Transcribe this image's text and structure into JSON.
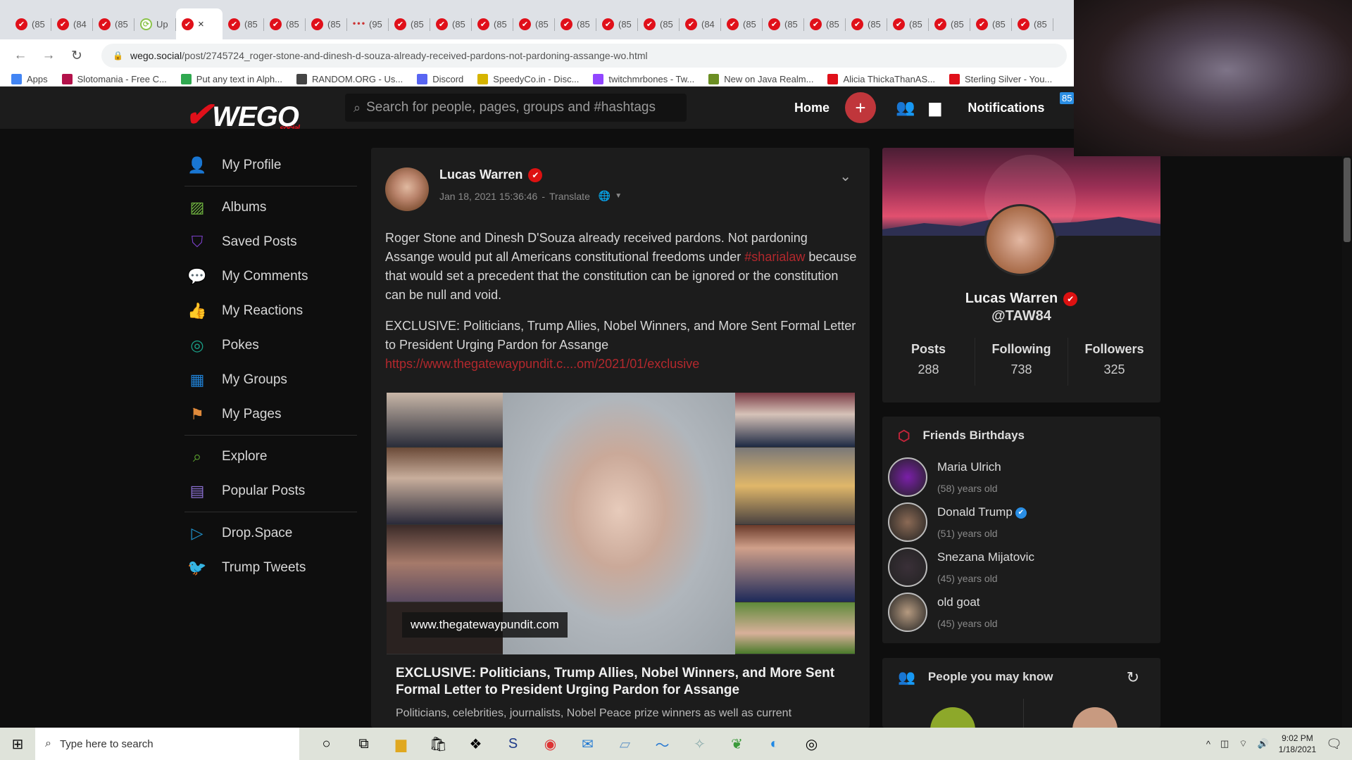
{
  "browser": {
    "tabs": [
      {
        "label": "(85",
        "icon": "wego"
      },
      {
        "label": "(84",
        "icon": "wego"
      },
      {
        "label": "(85",
        "icon": "wego"
      },
      {
        "label": "Up",
        "icon": "refresh-green"
      },
      {
        "label": "",
        "icon": "wego",
        "active": true
      },
      {
        "label": "(85",
        "icon": "wego"
      },
      {
        "label": "(85",
        "icon": "wego"
      },
      {
        "label": "(85",
        "icon": "wego"
      },
      {
        "label": "(95",
        "icon": "dots"
      },
      {
        "label": "(85",
        "icon": "wego"
      },
      {
        "label": "(85",
        "icon": "wego"
      },
      {
        "label": "(85",
        "icon": "wego"
      },
      {
        "label": "(85",
        "icon": "wego"
      },
      {
        "label": "(85",
        "icon": "wego"
      },
      {
        "label": "(85",
        "icon": "wego"
      },
      {
        "label": "(85",
        "icon": "wego"
      },
      {
        "label": "(84",
        "icon": "wego"
      },
      {
        "label": "(85",
        "icon": "wego"
      },
      {
        "label": "(85",
        "icon": "wego"
      },
      {
        "label": "(85",
        "icon": "wego"
      },
      {
        "label": "(85",
        "icon": "wego"
      },
      {
        "label": "(85",
        "icon": "wego"
      },
      {
        "label": "(85",
        "icon": "wego"
      },
      {
        "label": "(85",
        "icon": "wego"
      },
      {
        "label": "(85",
        "icon": "wego"
      }
    ],
    "active_tab_close": "×",
    "url_host": "wego.social",
    "url_path": "/post/2745724_roger-stone-and-dinesh-d-souza-already-received-pardons-not-pardoning-assange-wo.html",
    "bookmarks": [
      {
        "label": "Apps",
        "color": "#4285f4"
      },
      {
        "label": "Slotomania - Free C...",
        "color": "#b3124a"
      },
      {
        "label": "Put any text in Alph...",
        "color": "#2fa84f"
      },
      {
        "label": "RANDOM.ORG - Us...",
        "color": "#444444"
      },
      {
        "label": "Discord",
        "color": "#5865f2"
      },
      {
        "label": "SpeedyCo.in - Disc...",
        "color": "#d6b400"
      },
      {
        "label": "twitchmrbones - Tw...",
        "color": "#9146ff"
      },
      {
        "label": "New on Java Realm...",
        "color": "#6b8e23"
      },
      {
        "label": "Alicia ThickaThanAS...",
        "color": "#e0101a"
      },
      {
        "label": "Sterling Silver - You...",
        "color": "#e0101a"
      }
    ]
  },
  "header": {
    "logo": "WEGO",
    "logo_sub": "social",
    "search_placeholder": "Search for people, pages, groups and #hashtags",
    "home": "Home",
    "notifications": "Notifications",
    "notif_badge": "85",
    "accent": "#c0363b"
  },
  "sidebar": {
    "items": [
      {
        "label": "My Profile",
        "icon": "user-icon",
        "color": "#2ba3c4"
      },
      {
        "label": "Albums",
        "icon": "image-icon",
        "color": "#6fb33f"
      },
      {
        "label": "Saved Posts",
        "icon": "bookmark-pocket-icon",
        "color": "#7a3fc8"
      },
      {
        "label": "My Comments",
        "icon": "comment-icon",
        "color": "#cfcfcf"
      },
      {
        "label": "My Reactions",
        "icon": "thumbs-up-icon",
        "color": "#c8151b"
      },
      {
        "label": "Pokes",
        "icon": "target-icon",
        "color": "#1aa088"
      },
      {
        "label": "My Groups",
        "icon": "grid-icon",
        "color": "#1f7fd2"
      },
      {
        "label": "My Pages",
        "icon": "flag-icon",
        "color": "#e08a3b"
      },
      {
        "label": "Explore",
        "icon": "search-icon",
        "color": "#5fa830"
      },
      {
        "label": "Popular Posts",
        "icon": "document-icon",
        "color": "#8a6fd0"
      },
      {
        "label": "Drop.Space",
        "icon": "play-icon",
        "color": "#1f8fc8"
      },
      {
        "label": "Trump Tweets",
        "icon": "twitter-icon",
        "color": "#1f8fc8"
      }
    ]
  },
  "post": {
    "author": "Lucas Warren",
    "timestamp": "Jan 18, 2021 15:36:46",
    "translate": "Translate",
    "body_1": "Roger Stone and Dinesh D'Souza already received pardons. Not pardoning Assange would put all Americans constitutional freedoms under ",
    "hashtag": "#sharialaw",
    "body_2": " because that would set a precedent that the constitution can be ignored or the constitution can be null and void.",
    "body_3": "EXCLUSIVE: Politicians, Trump Allies, Nobel Winners, and More Sent Formal Letter to President Urging Pardon for Assange",
    "link": "https://www.thegatewaypundit.c....om/2021/01/exclusive",
    "image_caption": "www.thegatewaypundit.com",
    "link_title": "EXCLUSIVE: Politicians, Trump Allies, Nobel Winners, and More Sent Formal Letter to President Urging Pardon for Assange",
    "link_desc": "Politicians, celebrities, journalists, Nobel Peace prize winners as well as current"
  },
  "profile_card": {
    "name": "Lucas Warren",
    "handle": "@TAW84",
    "stats": [
      {
        "label": "Posts",
        "value": "288"
      },
      {
        "label": "Following",
        "value": "738"
      },
      {
        "label": "Followers",
        "value": "325"
      }
    ]
  },
  "birthdays": {
    "title": "Friends Birthdays",
    "items": [
      {
        "name": "Maria Ulrich",
        "age": "(58) years old",
        "verified": false,
        "color": "#7a1fa8"
      },
      {
        "name": "Donald Trump",
        "age": "(51) years old",
        "verified": true,
        "color": "#8b6a55"
      },
      {
        "name": "Snezana Mijatovic",
        "age": "(45) years old",
        "verified": false,
        "color": "#3a3038"
      },
      {
        "name": "old goat",
        "age": "(45) years old",
        "verified": false,
        "color": "#b59a80"
      }
    ]
  },
  "people": {
    "title": "People you may know"
  },
  "taskbar": {
    "search_placeholder": "Type here to search",
    "time": "9:02 PM",
    "date": "1/18/2021"
  }
}
